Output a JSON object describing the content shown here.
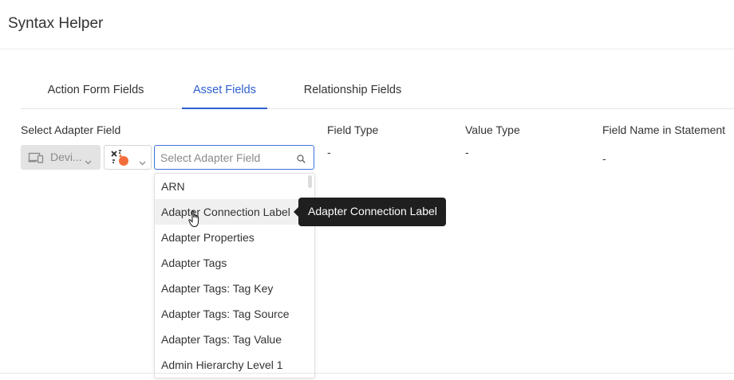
{
  "header": {
    "title": "Syntax Helper"
  },
  "tabs": [
    {
      "label": "Action Form Fields",
      "active": false
    },
    {
      "label": "Asset Fields",
      "active": true
    },
    {
      "label": "Relationship Fields",
      "active": false
    }
  ],
  "columns": {
    "adapter_field": "Select Adapter Field",
    "field_type": "Field Type",
    "value_type": "Value Type",
    "field_name": "Field Name in Statement"
  },
  "values": {
    "field_type": "-",
    "value_type": "-",
    "field_name": "-"
  },
  "device_select": {
    "label": "Devi...",
    "icon": "devices-icon"
  },
  "adapter_select": {
    "icon": "adapter-icon"
  },
  "search": {
    "placeholder": "Select Adapter Field",
    "value": "",
    "icon": "search-icon"
  },
  "dropdown": {
    "items": [
      "ARN",
      "Adapter Connection Label",
      "Adapter Properties",
      "Adapter Tags",
      "Adapter Tags: Tag Key",
      "Adapter Tags: Tag Source",
      "Adapter Tags: Tag Value",
      "Admin Hierarchy Level 1"
    ],
    "hovered_index": 1
  },
  "tooltip": {
    "text": "Adapter Connection Label"
  },
  "colors": {
    "accent": "#2f5fd0",
    "focus_border": "#3d74d6",
    "adapter_icon_orange": "#f36d3a",
    "tooltip_bg": "#1f1f1f"
  }
}
